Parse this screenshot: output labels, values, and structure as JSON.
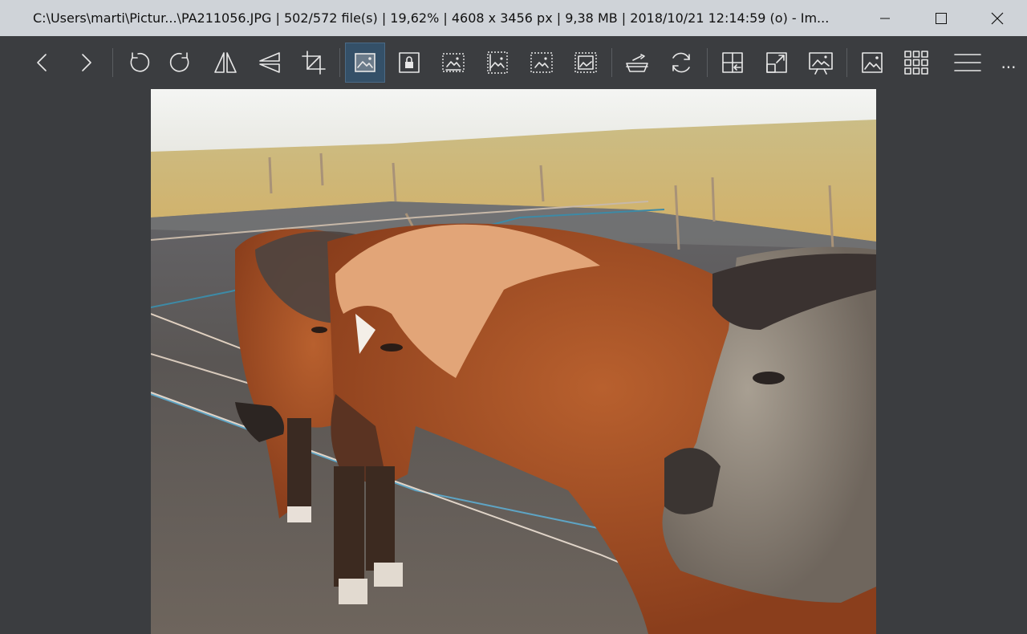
{
  "window": {
    "title": "C:\\Users\\marti\\Pictur...\\PA211056.JPG  |  502/572 file(s)  |  19,62%  |  4608 x 3456 px  |  9,38 MB  |  2018/10/21 12:14:59 (o)  - Im..."
  },
  "toolbar": {
    "more_label": "..."
  },
  "colors": {
    "titlebar_bg": "#cfd3d8",
    "toolbar_bg": "#3b3d40",
    "active_button_bg": "#345068"
  }
}
